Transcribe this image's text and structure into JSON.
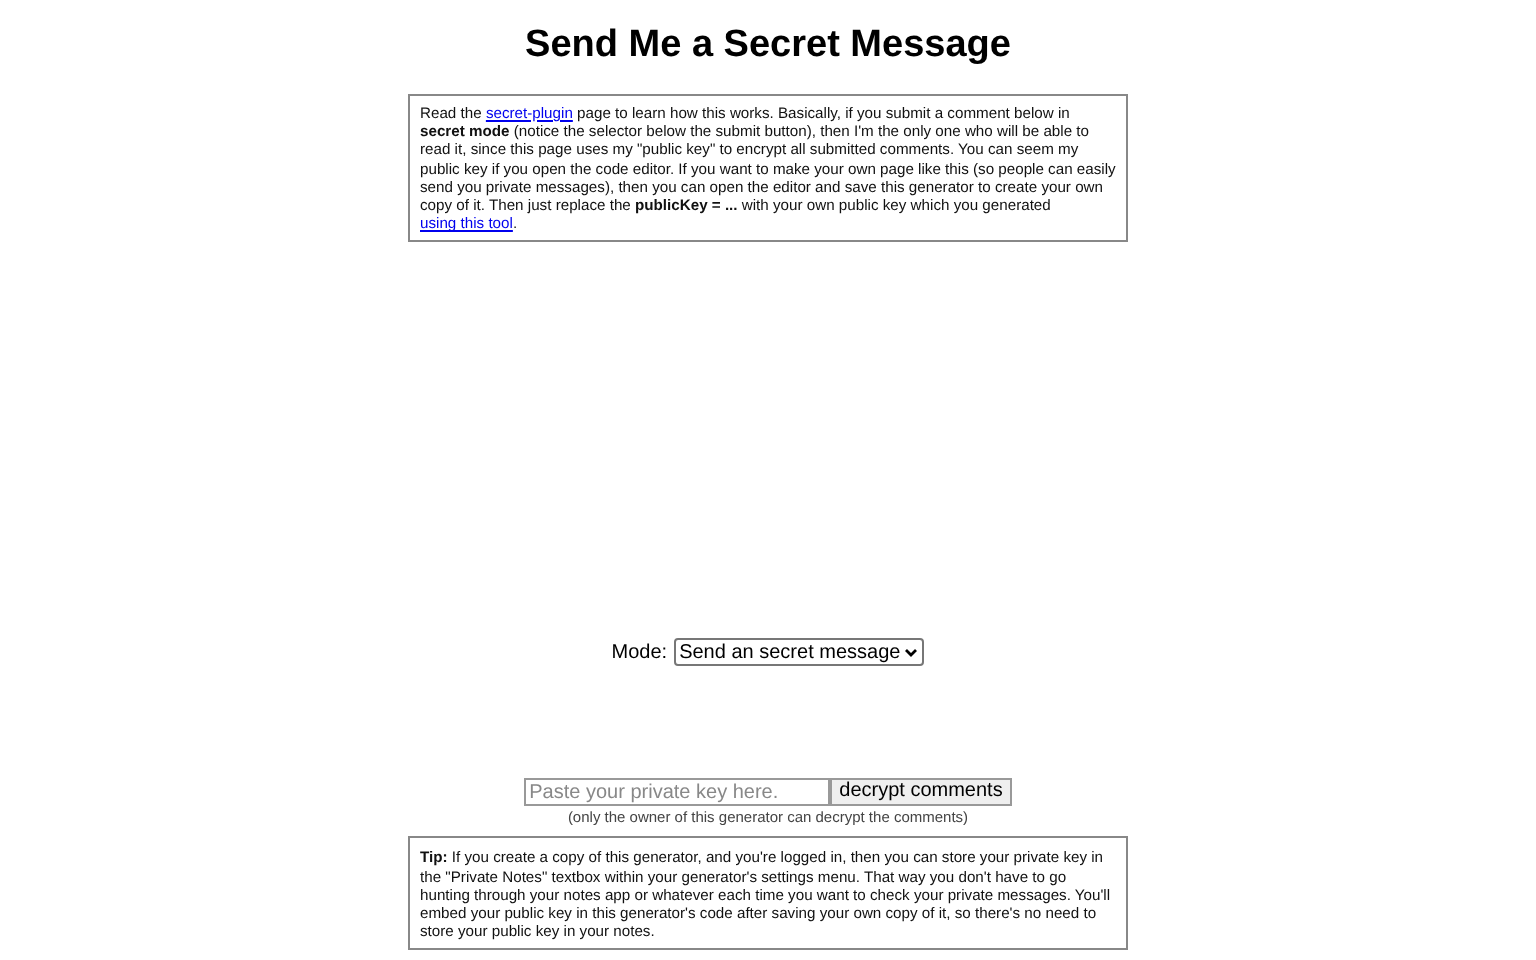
{
  "title": "Send Me a Secret Message",
  "intro": [
    {
      "kind": "text",
      "text": "Read the "
    },
    {
      "kind": "link",
      "text": "secret-plugin"
    },
    {
      "kind": "text",
      "text": " page to learn how this works. Basically, if you submit a comment below in **secret mode** (notice the selector below the submit button), then I'm the only one who will be able to read it, since this page uses my \"public key\" to encrypt all submitted comments. You can seem my public key if you open the code editor. If you want to make your own page like this (so people can easily send you private messages), then you can open the editor and save this generator to create your own copy of it. Then just replace the **publicKey = ...** with your own public key which you generated "
    },
    {
      "kind": "link",
      "text": "using this tool"
    },
    {
      "kind": "text",
      "text": "."
    }
  ],
  "mode": {
    "label": "Mode:",
    "value": "Send an secret message"
  },
  "decrypt": {
    "placeholder": "Paste your private key here.",
    "button": "decrypt comments",
    "note": "(only the owner of this generator can decrypt the comments)"
  },
  "tip": "**Tip:** If you create a copy of this generator, and you're logged in, then you can store your private key in the \"Private Notes\" textbox within your generator's settings menu. That way you don't have to go hunting through your notes app or whatever each time you want to check your private messages. You'll embed your public key in this generator's code after saving your own copy of it, so there's no need to store your public key in your notes."
}
